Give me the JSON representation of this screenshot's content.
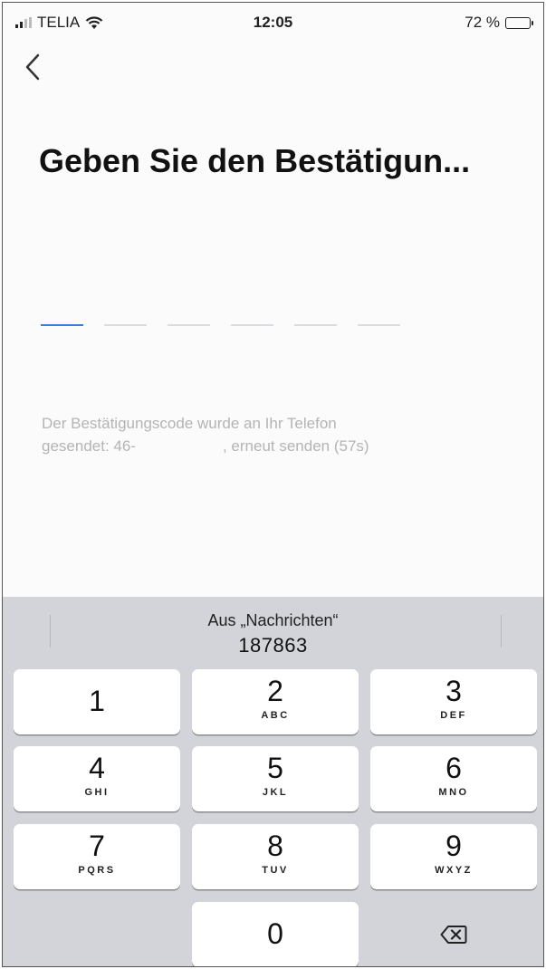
{
  "status_bar": {
    "carrier": "TELIA",
    "time": "12:05",
    "battery": "72 %",
    "battery_level": 0.72
  },
  "header": {
    "back_icon": "chevron-left-icon",
    "title": "Geben Sie den Bestätigun..."
  },
  "code_entry": {
    "slots": 6,
    "active_slot": 1
  },
  "info": {
    "line1": "Der Bestätigungscode wurde an Ihr Telefon",
    "sent_prefix": "gesendet: 46-",
    "resend": ", erneut senden (57s)"
  },
  "keyboard": {
    "suggestion_source": "Aus „Nachrichten“",
    "suggestion_code": "187863",
    "keys": [
      {
        "digit": "1",
        "letters": ""
      },
      {
        "digit": "2",
        "letters": "ABC"
      },
      {
        "digit": "3",
        "letters": "DEF"
      },
      {
        "digit": "4",
        "letters": "GHI"
      },
      {
        "digit": "5",
        "letters": "JKL"
      },
      {
        "digit": "6",
        "letters": "MNO"
      },
      {
        "digit": "7",
        "letters": "PQRS"
      },
      {
        "digit": "8",
        "letters": "TUV"
      },
      {
        "digit": "9",
        "letters": "WXYZ"
      },
      {
        "digit": "0",
        "letters": ""
      }
    ],
    "delete_icon": "backspace-icon"
  },
  "colors": {
    "accent": "#3d7fd6",
    "keyboard_bg": "#d2d4d9",
    "hint_text": "#b4b4b4"
  }
}
